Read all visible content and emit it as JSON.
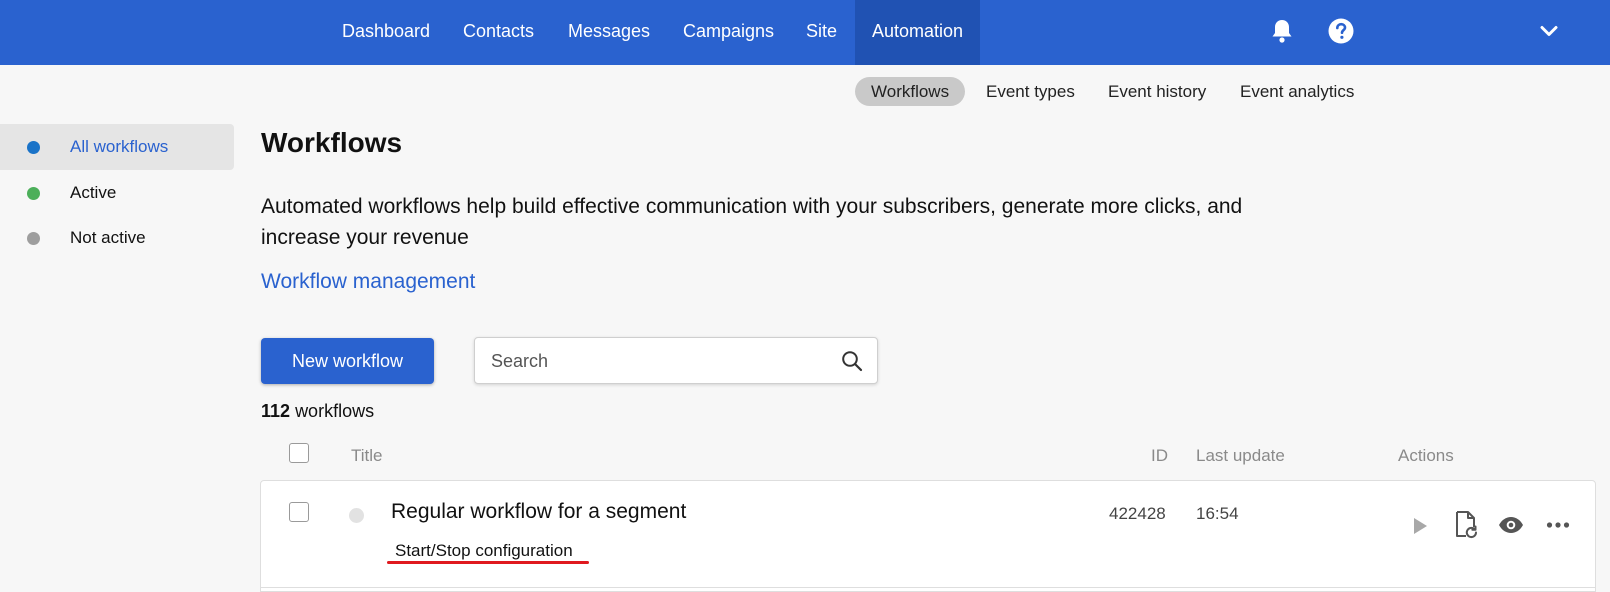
{
  "topnav": {
    "items": [
      {
        "label": "Dashboard"
      },
      {
        "label": "Contacts"
      },
      {
        "label": "Messages"
      },
      {
        "label": "Campaigns"
      },
      {
        "label": "Site"
      },
      {
        "label": "Automation",
        "active": true
      }
    ],
    "icons": [
      "bell-icon",
      "help-icon",
      "chevron-down-icon"
    ],
    "bg_color": "#2a62cf",
    "active_bg_color": "#2052b3"
  },
  "subnav": {
    "items": [
      {
        "label": "Workflows",
        "active": true
      },
      {
        "label": "Event types"
      },
      {
        "label": "Event history"
      },
      {
        "label": "Event analytics"
      }
    ]
  },
  "sidebar": {
    "items": [
      {
        "label": "All workflows",
        "dot_color": "#1a73c8",
        "selected": true
      },
      {
        "label": "Active",
        "dot_color": "#4caf5a"
      },
      {
        "label": "Not active",
        "dot_color": "#9e9e9e"
      }
    ]
  },
  "main": {
    "title": "Workflows",
    "description": "Automated workflows help build effective communication with your subscribers, generate more clicks, and increase your revenue",
    "management_link": "Workflow management",
    "new_button": "New workflow",
    "search_placeholder": "Search",
    "count_number": "112",
    "count_label": "workflows"
  },
  "table": {
    "headers": {
      "title": "Title",
      "id": "ID",
      "last_update": "Last update",
      "actions": "Actions"
    },
    "rows": [
      {
        "title": "Regular workflow for a segment",
        "subtitle": "Start/Stop configuration",
        "id": "422428",
        "last_update": "16:54",
        "actions": [
          "play-icon",
          "document-restore-icon",
          "eye-icon",
          "more-icon"
        ]
      }
    ]
  },
  "colors": {
    "accent": "#2a62cf",
    "annotation_underline": "#e0191f"
  }
}
